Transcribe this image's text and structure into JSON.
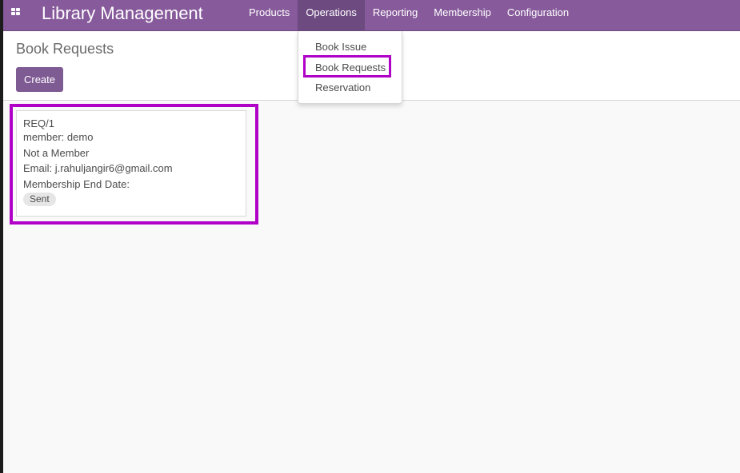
{
  "navbar": {
    "app_title": "Library Management",
    "apps_icon": "apps-grid-icon",
    "menu": [
      "Products",
      "Operations",
      "Reporting",
      "Membership",
      "Configuration"
    ],
    "active_menu": "Operations"
  },
  "dropdown": {
    "items": [
      "Book Issue",
      "Book Requests",
      "Reservation"
    ],
    "highlighted_item": "Book Requests"
  },
  "page": {
    "title": "Book Requests",
    "create_label": "Create"
  },
  "card": {
    "ref": "REQ/1",
    "member": "member: demo",
    "member_status": "Not a Member",
    "email": "Email: j.rahuljangir6@gmail.com",
    "membership_end": "Membership End Date:",
    "state": "Sent"
  },
  "colors": {
    "brand": "#875a9b",
    "active_menu": "#6d4a80",
    "button": "#7f5b94",
    "annotation_highlight": "#b000c8"
  }
}
